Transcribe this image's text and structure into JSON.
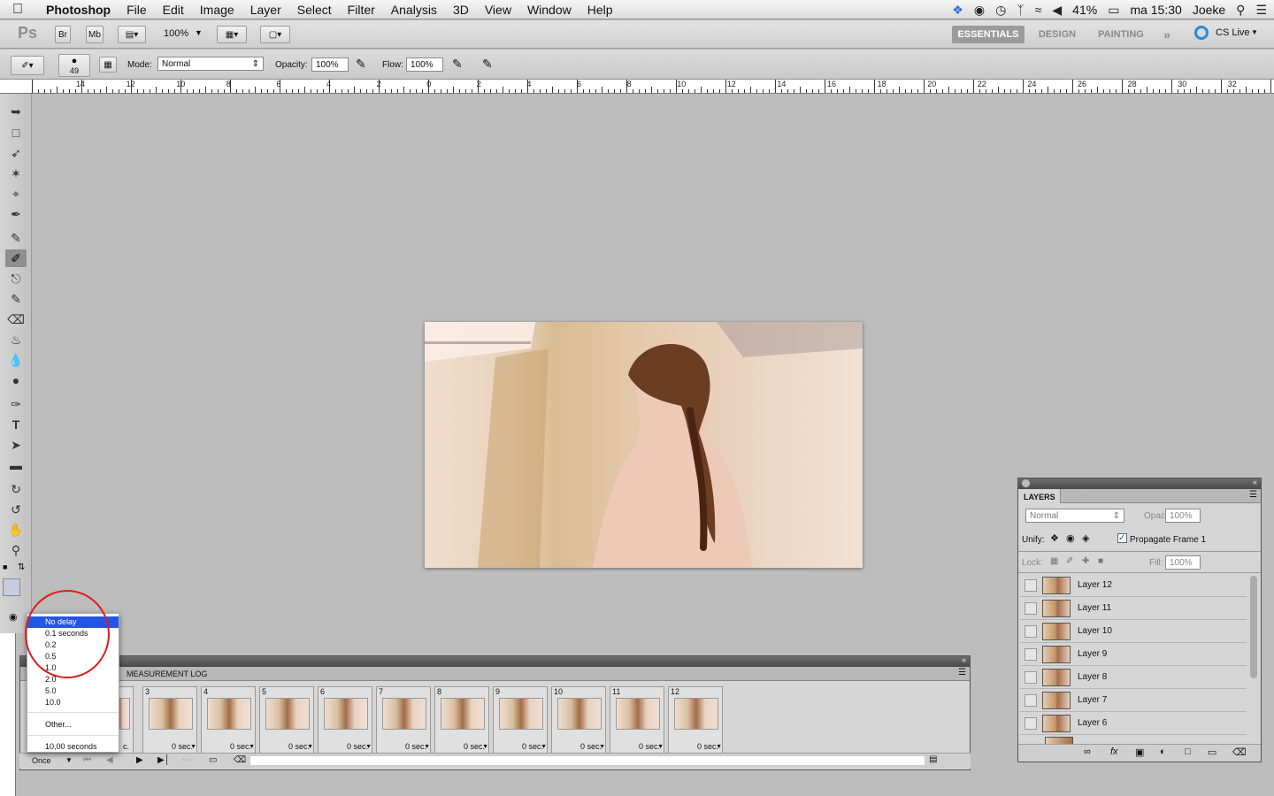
{
  "menubar": {
    "app_name": "Photoshop",
    "items": [
      "File",
      "Edit",
      "Image",
      "Layer",
      "Select",
      "Filter",
      "Analysis",
      "3D",
      "View",
      "Window",
      "Help"
    ],
    "battery": "41%",
    "clock": "ma 15:30",
    "user": "Joeke"
  },
  "appbar": {
    "logo": "Ps",
    "bridge": "Br",
    "minibridge": "Mb",
    "zoom": "100%",
    "workspaces": [
      "ESSENTIALS",
      "DESIGN",
      "PAINTING"
    ],
    "more": "»",
    "cslive": "CS Live"
  },
  "options": {
    "brush_size": "49",
    "mode_label": "Mode:",
    "mode_value": "Normal",
    "opacity_label": "Opacity:",
    "opacity_value": "100%",
    "flow_label": "Flow:",
    "flow_value": "100%"
  },
  "ruler": {
    "labels": [
      "14",
      "12",
      "10",
      "8",
      "6",
      "4",
      "2",
      "0",
      "2",
      "4",
      "6",
      "8",
      "10",
      "12",
      "14",
      "16",
      "18",
      "20",
      "22",
      "24",
      "26",
      "28",
      "30",
      "32"
    ]
  },
  "layers": {
    "tab": "LAYERS",
    "blend": "Normal",
    "opacity_label": "Opacity:",
    "opacity_value": "100%",
    "unify_label": "Unify:",
    "propagate": "Propagate Frame 1",
    "lock_label": "Lock:",
    "fill_label": "Fill:",
    "fill_value": "100%",
    "rows": [
      "Layer 12",
      "Layer 11",
      "Layer 10",
      "Layer 9",
      "Layer 8",
      "Layer 7",
      "Layer 6"
    ]
  },
  "animation": {
    "tab2": "MEASUREMENT LOG",
    "frames": [
      {
        "num": "3",
        "delay": "0 sec."
      },
      {
        "num": "4",
        "delay": "0 sec."
      },
      {
        "num": "5",
        "delay": "0 sec."
      },
      {
        "num": "6",
        "delay": "0 sec."
      },
      {
        "num": "7",
        "delay": "0 sec."
      },
      {
        "num": "8",
        "delay": "0 sec."
      },
      {
        "num": "9",
        "delay": "0 sec."
      },
      {
        "num": "10",
        "delay": "0 sec."
      },
      {
        "num": "11",
        "delay": "0 sec."
      },
      {
        "num": "12",
        "delay": "0 sec."
      }
    ],
    "partial_delay": "c.",
    "loop": "Once"
  },
  "dropdown": {
    "items": [
      "No delay",
      "0.1 seconds",
      "0.2",
      "0.5",
      "1.0",
      "2.0",
      "5.0",
      "10.0",
      "Other...",
      "10,00 seconds"
    ],
    "selected": "No delay"
  },
  "colors": {
    "accent": "#2356e6",
    "annotation": "#e01b1b"
  }
}
